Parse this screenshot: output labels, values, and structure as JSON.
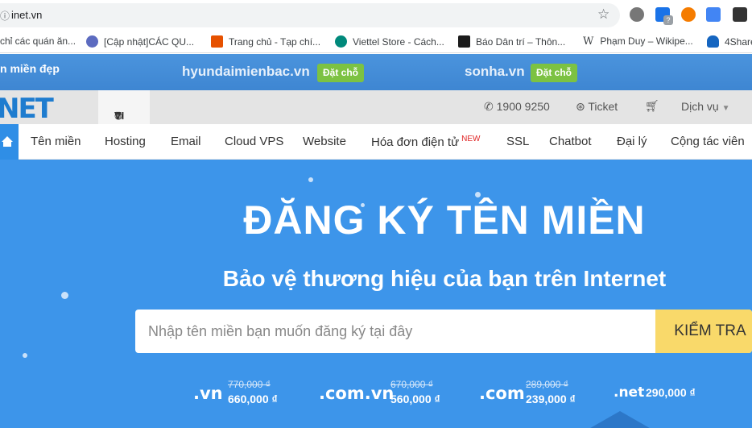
{
  "browser": {
    "url": "inet.vn",
    "lock_icon": "info-icon",
    "extensions": [
      "gear-extension-icon",
      "chart-extension-icon",
      "flower-extension-icon",
      "translate-extension-icon",
      "m-extension-icon"
    ],
    "ext_badge": "?"
  },
  "bookmarks": [
    {
      "label": "chỉ các quán ăn...",
      "icon": "none"
    },
    {
      "label": "[Cập nhật]CÁC QU...",
      "icon": "globe-icon",
      "color": "#5c6bc0"
    },
    {
      "label": "Trang chủ - Tạp chí...",
      "icon": "colorful-icon",
      "color": "#e65100"
    },
    {
      "label": "Viettel Store - Cách...",
      "icon": "viettel-icon",
      "color": "#00897b"
    },
    {
      "label": "Báo Dân trí – Thôn...",
      "icon": "d-icon",
      "color": "#1b1b1b"
    },
    {
      "label": "Phạm Duy – Wikipe...",
      "icon": "wikipedia-icon",
      "glyph": "W"
    },
    {
      "label": "4Share",
      "icon": "cloud-icon",
      "color": "#1565c0"
    }
  ],
  "promo": {
    "left_text": "n miền đẹp",
    "domains": [
      {
        "name": "hyundaimienbac.vn",
        "button": "Đặt chỗ"
      },
      {
        "name": "sonha.vn",
        "button": "Đặt chỗ"
      }
    ]
  },
  "header": {
    "logo": "NET",
    "lang_icon": "globe-icon",
    "lang": "VI",
    "phone": "1900 9250",
    "ticket": "Ticket",
    "service": "Dịch vụ"
  },
  "nav": {
    "items": [
      "Tên miền",
      "Hosting",
      "Email",
      "Cloud VPS",
      "Website",
      "Hóa đơn điện tử",
      "SSL",
      "Chatbot",
      "Đại lý",
      "Cộng tác viên"
    ],
    "new_badge": "NEW"
  },
  "hero": {
    "title": "ĐĂNG KÝ TÊN MIỀN",
    "subtitle": "Bảo vệ thương hiệu của bạn trên Internet",
    "search_placeholder": "Nhập tên miền bạn muốn đăng ký tại đây",
    "search_button": "KIỂM TRA",
    "prices": [
      {
        "tld": ".vn",
        "old": "770,000 ₫",
        "new": "660,000 ₫"
      },
      {
        "tld": ".com.vn",
        "old": "670,000 ₫",
        "new": "560,000 ₫"
      },
      {
        "tld": ".com",
        "old": "289,000 ₫",
        "new": "239,000 ₫"
      },
      {
        "tld": ".net",
        "old": "",
        "new": "290,000 ₫"
      }
    ]
  },
  "colors": {
    "brand": "#1e7ccf",
    "hero_bg": "#3d95ea",
    "search_button": "#f9d96a",
    "promo_button": "#7cc242"
  }
}
